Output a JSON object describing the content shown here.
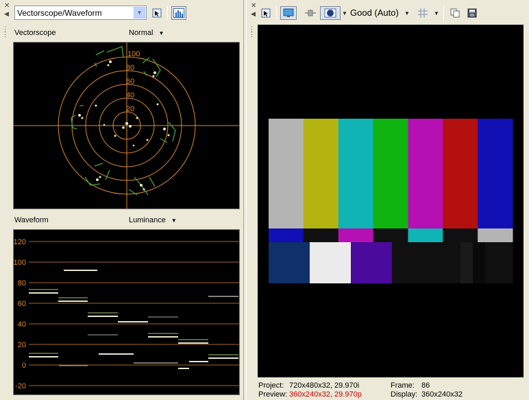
{
  "left_panel": {
    "scope_selector_value": "Vectorscope/Waveform",
    "vectorscope": {
      "label": "Vectorscope",
      "mode": "Normal",
      "ring_labels": [
        "100",
        "80",
        "60",
        "40",
        "20"
      ]
    },
    "waveform": {
      "label": "Waveform",
      "mode": "Luminance",
      "y_labels": [
        "120",
        "100",
        "80",
        "60",
        "40",
        "20",
        "0",
        "-20"
      ]
    }
  },
  "right_panel": {
    "quality": "Good (Auto)",
    "status": {
      "project_label": "Project:",
      "project_value": "720x480x32, 29.970i",
      "preview_label": "Preview:",
      "preview_value": "360x240x32, 29.970p",
      "frame_label": "Frame:",
      "frame_value": "86",
      "display_label": "Display:",
      "display_value": "360x240x32"
    },
    "colors": {
      "top_bars": [
        "#b4b4b4",
        "#b4b410",
        "#10b4b4",
        "#10b410",
        "#b410b4",
        "#b41010",
        "#1010b4"
      ],
      "mid_bars": [
        "#1010b4",
        "#101010",
        "#b410b4",
        "#101010",
        "#10b4b4",
        "#101010",
        "#b4b4b4"
      ],
      "bottom_bars": [
        "#10306a",
        "#ebebeb",
        "#4a0a9c",
        "#101010",
        "#101010",
        "#101010",
        "#1a1a1a",
        "#0a0a0a",
        "#101010"
      ]
    }
  }
}
